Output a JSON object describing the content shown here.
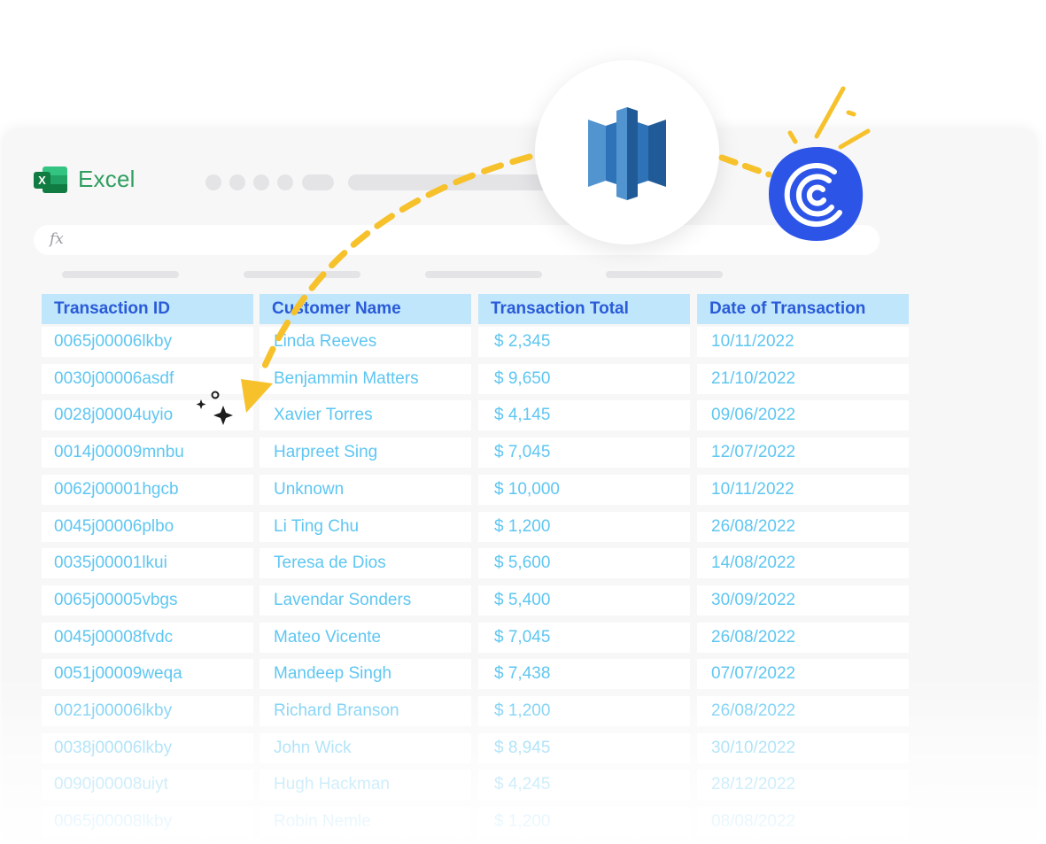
{
  "app": {
    "name": "Excel",
    "formula_placeholder": "fx",
    "accent": "#2f9e5e",
    "header_bg": "#bfe6fb",
    "header_text": "#2a5bd8",
    "cell_text": "#5ec6f2"
  },
  "table": {
    "columns": [
      "Transaction ID",
      "Customer Name",
      "Transaction Total",
      "Date of Transaction"
    ],
    "rows": [
      [
        "0065j00006lkby",
        "Linda Reeves",
        "$ 2,345",
        "10/11/2022"
      ],
      [
        "0030j00006asdf",
        "Benjammin Matters",
        "$ 9,650",
        "21/10/2022"
      ],
      [
        "0028j00004uyio",
        "Xavier Torres",
        "$ 4,145",
        "09/06/2022"
      ],
      [
        "0014j00009mnbu",
        "Harpreet Sing",
        "$ 7,045",
        "12/07/2022"
      ],
      [
        "0062j00001hgcb",
        "Unknown",
        "$ 10,000",
        "10/11/2022"
      ],
      [
        "0045j00006plbo",
        "Li Ting Chu",
        "$ 1,200",
        "26/08/2022"
      ],
      [
        "0035j00001lkui",
        "Teresa de Dios",
        "$ 5,600",
        "14/08/2022"
      ],
      [
        "0065j00005vbgs",
        "Lavendar Sonders",
        "$ 5,400",
        "30/09/2022"
      ],
      [
        "0045j00008fvdc",
        "Mateo Vicente",
        "$ 7,045",
        "26/08/2022"
      ],
      [
        "0051j00009weqa",
        "Mandeep Singh",
        "$ 7,438",
        "07/07/2022"
      ],
      [
        "0021j00006lkby",
        "Richard Branson",
        "$ 1,200",
        "26/08/2022"
      ],
      [
        "0038j00006lkby",
        "John Wick",
        "$ 8,945",
        "30/10/2022"
      ],
      [
        "0090j00008uiyt",
        "Hugh Hackman",
        "$ 4,245",
        "28/12/2022"
      ],
      [
        "0065j00008lkby",
        "Robin Nemle",
        "$ 1,200",
        "08/08/2022"
      ]
    ]
  },
  "icons": {
    "warehouse": "redshift-icon",
    "destination": "census-icon",
    "sparkle": "sparkle-icon",
    "arrow": "yellow-arrow",
    "arrow_color": "#f6c12b",
    "census_color": "#2c55e8"
  }
}
